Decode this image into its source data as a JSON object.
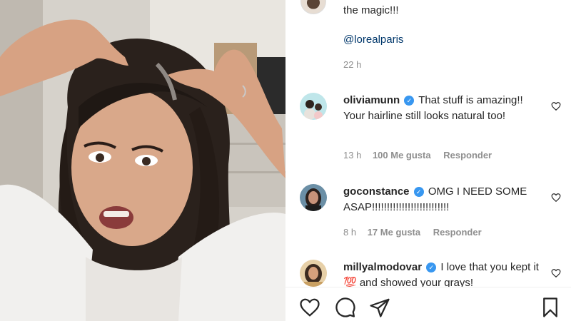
{
  "caption": {
    "text": "the magic!!!",
    "mention": "@lorealparis",
    "time": "22 h"
  },
  "comments": [
    {
      "username": "oliviamunn",
      "verified": true,
      "text": "That stuff is amazing!! Your hairline still looks natural too!",
      "time": "13 h",
      "likes": "100 Me gusta",
      "reply": "Responder"
    },
    {
      "username": "goconstance",
      "verified": true,
      "text": "OMG I NEED SOME ASAP!!!!!!!!!!!!!!!!!!!!!!!!!!",
      "time": "8 h",
      "likes": "17 Me gusta",
      "reply": "Responder"
    },
    {
      "username": "millyalmodovar",
      "verified": true,
      "text": "I love that you kept it 💯 and showed your grays!",
      "time": "",
      "likes": "",
      "reply": ""
    }
  ],
  "icons": {
    "verified": "verified-badge-icon",
    "like": "heart-icon",
    "comment": "comment-icon",
    "share": "share-icon",
    "save": "bookmark-icon"
  },
  "colors": {
    "verified": "#3897f0",
    "mention": "#00376b",
    "meta": "#8e8e8e"
  }
}
